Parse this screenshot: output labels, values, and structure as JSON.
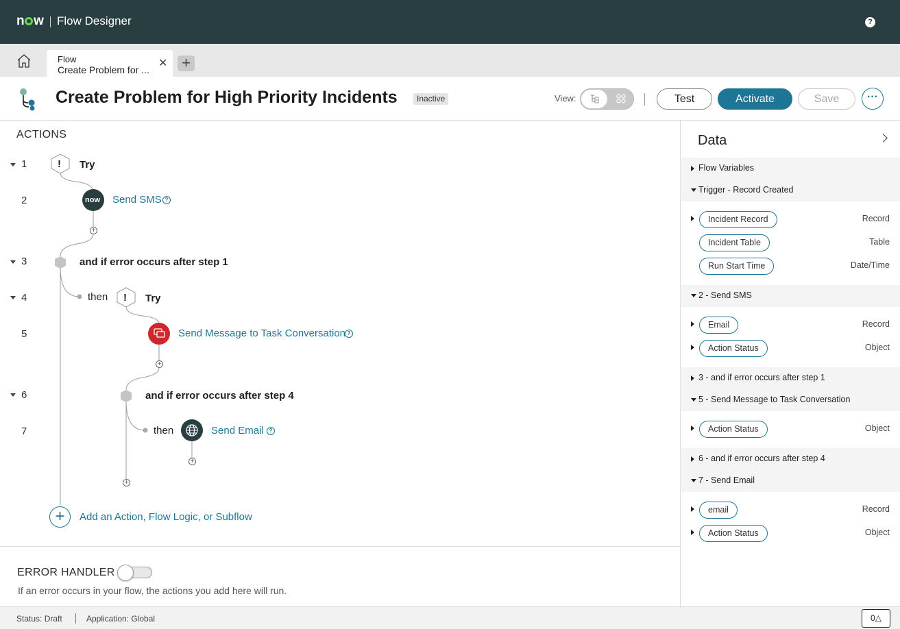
{
  "app": {
    "brand": "now",
    "title": "Flow Designer"
  },
  "tabs": [
    {
      "kind": "Flow",
      "name": "Create Problem for ..."
    }
  ],
  "header": {
    "title": "Create Problem for High Priority Incidents",
    "status": "Inactive",
    "view_label": "View:",
    "buttons": {
      "test": "Test",
      "activate": "Activate",
      "save": "Save",
      "more": "···"
    }
  },
  "actions": {
    "heading": "ACTIONS",
    "steps": [
      {
        "num": "1",
        "label": "Try"
      },
      {
        "num": "2",
        "label": "Send SMS",
        "icon_text": "now"
      },
      {
        "num": "3",
        "label": "and if error occurs after step 1"
      },
      {
        "num": "4",
        "prefix": "then",
        "label": "Try"
      },
      {
        "num": "5",
        "label": "Send Message to Task Conversation"
      },
      {
        "num": "6",
        "label": "and if error occurs after step 4"
      },
      {
        "num": "7",
        "prefix": "then",
        "label": "Send Email"
      }
    ],
    "add_label": "Add an Action, Flow Logic, or Subflow"
  },
  "error_handler": {
    "title": "ERROR HANDLER",
    "description": "If an error occurs in your flow, the actions you add here will run."
  },
  "statusbar": {
    "status": "Status: Draft",
    "application": "Application: Global",
    "notifications": "0"
  },
  "data_panel": {
    "title": "Data",
    "sections": [
      {
        "label": "Flow Variables",
        "expanded": false,
        "items": []
      },
      {
        "label": "Trigger - Record Created",
        "expanded": true,
        "items": [
          {
            "name": "Incident Record",
            "type": "Record",
            "expandable": true
          },
          {
            "name": "Incident Table",
            "type": "Table",
            "expandable": false
          },
          {
            "name": "Run Start Time",
            "type": "Date/Time",
            "expandable": false
          }
        ]
      },
      {
        "label": "2 - Send SMS",
        "expanded": true,
        "items": [
          {
            "name": "Email",
            "type": "Record",
            "expandable": true
          },
          {
            "name": "Action Status",
            "type": "Object",
            "expandable": true
          }
        ]
      },
      {
        "label": "3 - and if error occurs after step 1",
        "expanded": false,
        "items": []
      },
      {
        "label": "5 - Send Message to Task Conversation",
        "expanded": true,
        "items": [
          {
            "name": "Action Status",
            "type": "Object",
            "expandable": true
          }
        ]
      },
      {
        "label": "6 - and if error occurs after step 4",
        "expanded": false,
        "items": []
      },
      {
        "label": "7 - Send Email",
        "expanded": true,
        "items": [
          {
            "name": "email",
            "type": "Record",
            "expandable": true
          },
          {
            "name": "Action Status",
            "type": "Object",
            "expandable": true
          }
        ]
      }
    ]
  },
  "colors": {
    "topbar": "#293e40",
    "accent": "#1e7696",
    "brand_green": "#62d84e",
    "error_red": "#d0262e"
  }
}
